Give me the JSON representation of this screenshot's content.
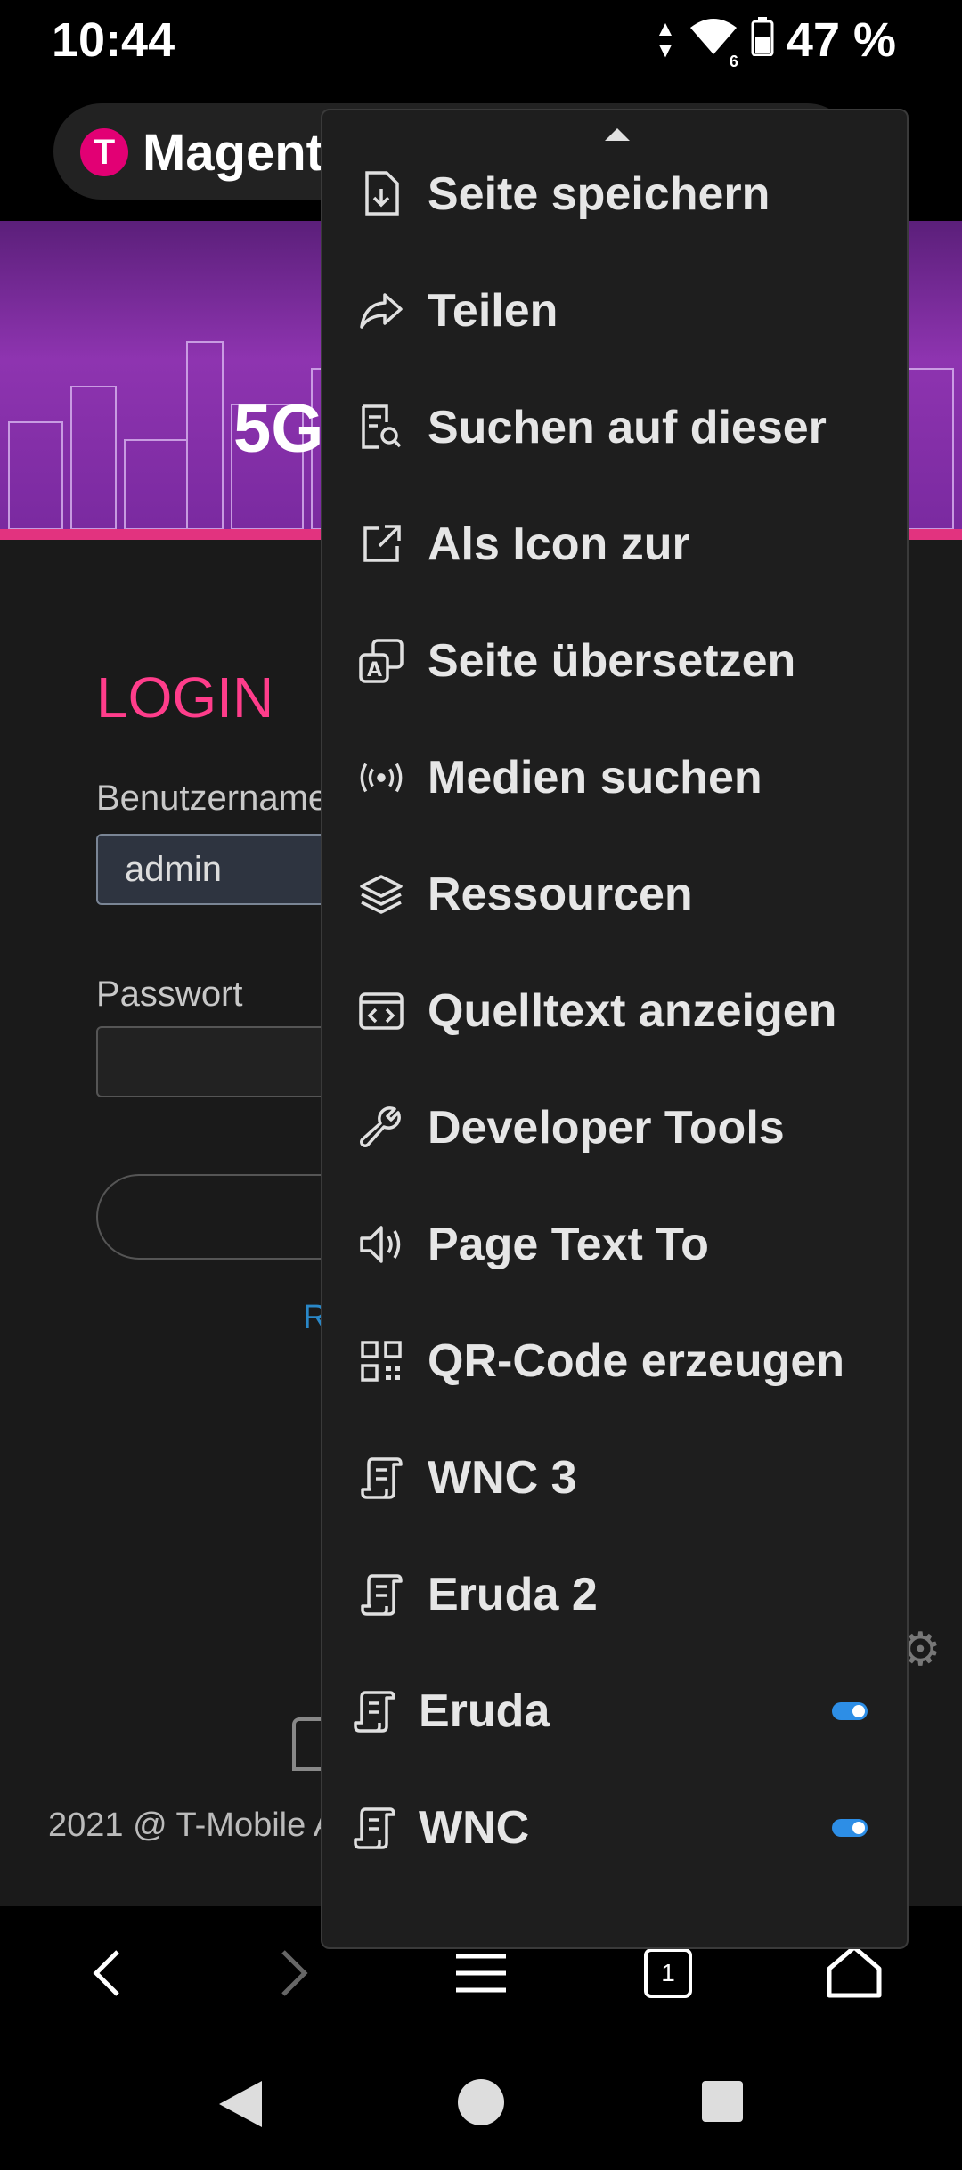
{
  "status_bar": {
    "time": "10:44",
    "network_type": "6",
    "battery": "47 %"
  },
  "browser_bar": {
    "title": "Magent"
  },
  "banner": {
    "label": "5G"
  },
  "login": {
    "title": "LOGIN",
    "username_label": "Benutzername",
    "username_value": "admin",
    "password_label": "Passwort",
    "reset_text": "R"
  },
  "footer": {
    "text": "2021 @ T-Mobile A"
  },
  "bottom_nav": {
    "tab_count": "1"
  },
  "menu": {
    "items": [
      {
        "label": "Seite speichern",
        "icon": "save-page-icon"
      },
      {
        "label": "Teilen",
        "icon": "share-icon"
      },
      {
        "label": "Suchen auf dieser",
        "icon": "find-in-page-icon"
      },
      {
        "label": "Als Icon zur",
        "icon": "add-shortcut-icon"
      },
      {
        "label": "Seite übersetzen",
        "icon": "translate-icon"
      },
      {
        "label": "Medien suchen",
        "icon": "media-search-icon"
      },
      {
        "label": "Ressourcen",
        "icon": "layers-icon"
      },
      {
        "label": "Quelltext anzeigen",
        "icon": "view-source-icon"
      },
      {
        "label": "Developer Tools",
        "icon": "wrench-icon"
      },
      {
        "label": "Page Text To",
        "icon": "speaker-icon"
      },
      {
        "label": "QR-Code erzeugen",
        "icon": "qr-code-icon"
      },
      {
        "label": "WNC 3",
        "icon": "script-icon"
      },
      {
        "label": "Eruda 2",
        "icon": "script-icon"
      },
      {
        "label": "Eruda",
        "icon": "script-icon",
        "toggle": "on"
      },
      {
        "label": "WNC",
        "icon": "script-icon",
        "toggle": "on"
      }
    ]
  },
  "colors": {
    "accent_pink": "#ff3d8b",
    "telekom_magenta": "#e20074",
    "toggle_blue": "#2d8ee6"
  }
}
